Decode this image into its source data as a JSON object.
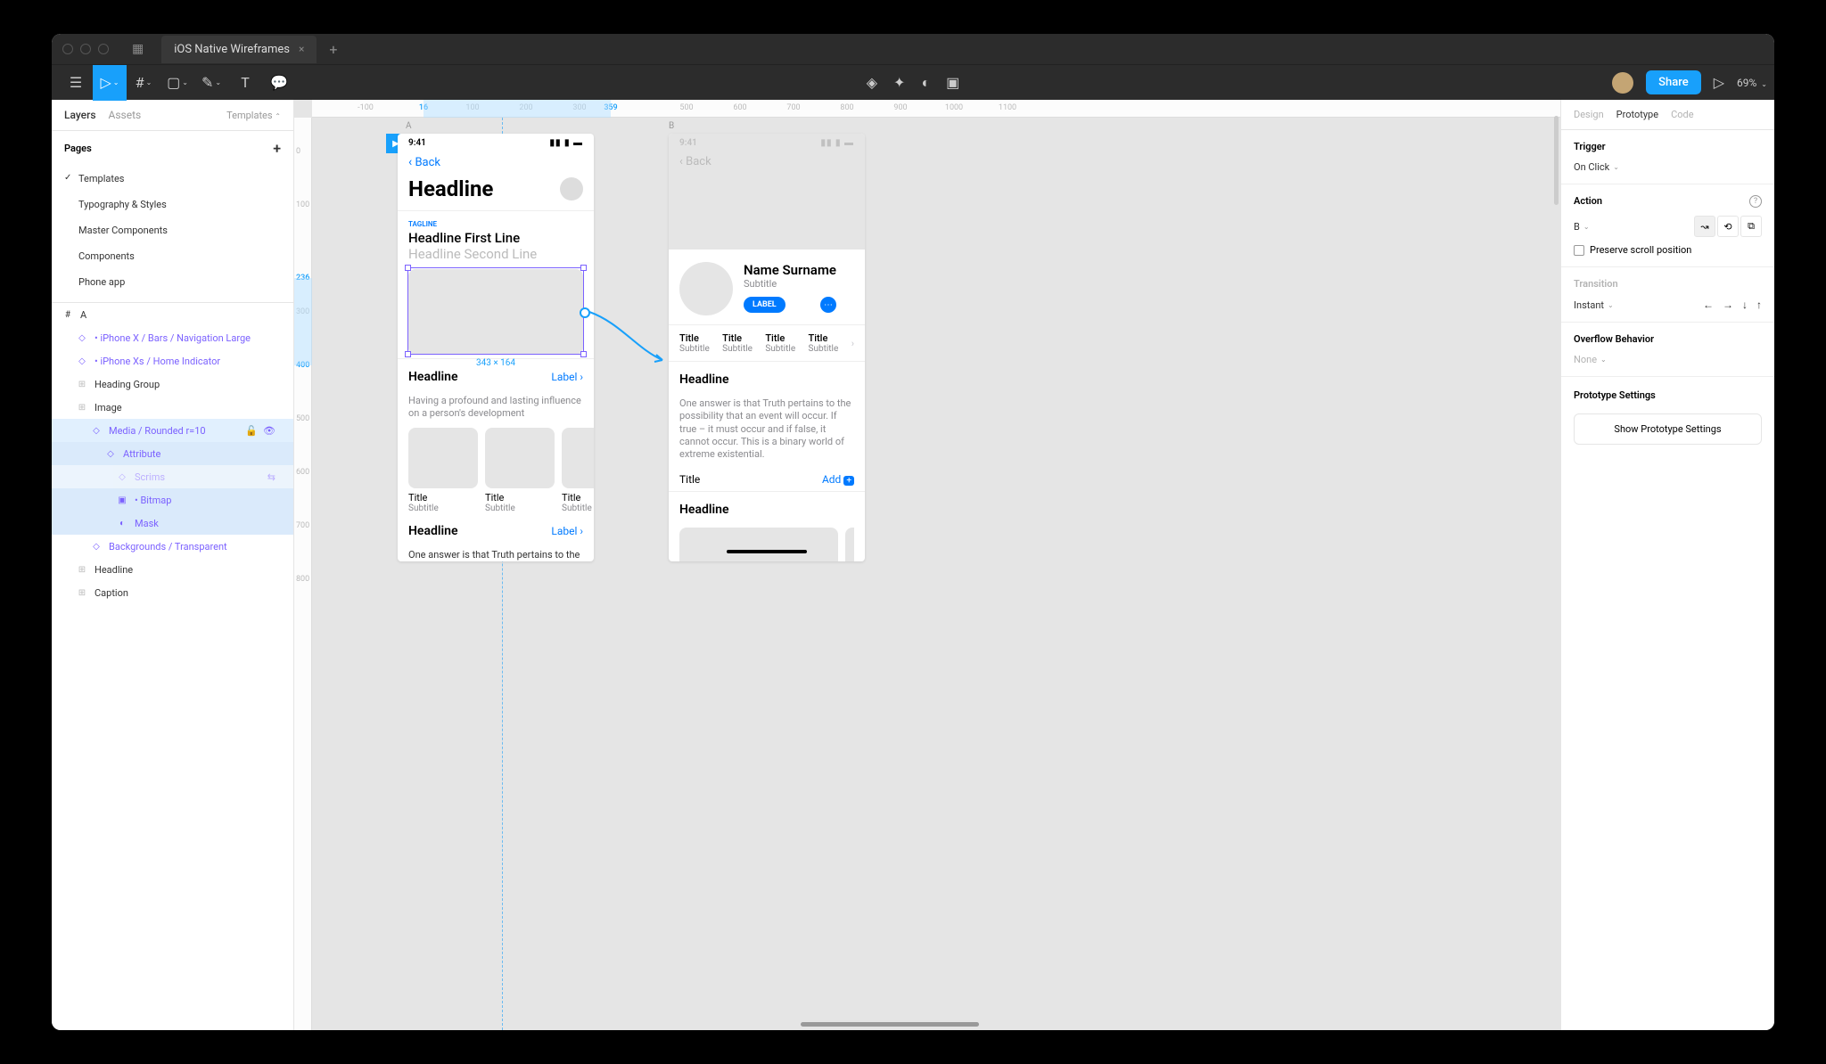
{
  "titlebar": {
    "tab_name": "iOS Native Wireframes"
  },
  "toolbar": {
    "share": "Share",
    "zoom": "69%"
  },
  "left": {
    "tabs": {
      "layers": "Layers",
      "assets": "Assets",
      "templates": "Templates"
    },
    "pages_label": "Pages",
    "pages": [
      "Templates",
      "Typography & Styles",
      "Master Components",
      "Components",
      "Phone app"
    ],
    "frame": "A",
    "layers": {
      "nav_large": "• iPhone X / Bars / Navigation Large",
      "home_ind": "• iPhone Xs / Home Indicator",
      "heading_group": "Heading Group",
      "image": "Image",
      "media_rounded": "Media / Rounded r=10",
      "attribute": "Attribute",
      "scrims": "Scrims",
      "bitmap": "• Bitmap",
      "mask": "Mask",
      "backgrounds": "Backgrounds / Transparent",
      "headline": "Headline",
      "caption": "Caption"
    }
  },
  "ruler": {
    "h": {
      "n100": "-100",
      "p16": "16",
      "p100": "100",
      "p200": "200",
      "p300": "300",
      "p359": "359",
      "p500": "500",
      "p600": "600",
      "p700": "700",
      "p800": "800",
      "p900": "900",
      "p1000": "1000",
      "p1100": "1100"
    },
    "v": {
      "p0": "0",
      "p100": "100",
      "p236": "236",
      "p300": "300",
      "p400": "400",
      "p500": "500",
      "p600": "600",
      "p700": "700",
      "p800": "800"
    }
  },
  "canvas": {
    "frame_a": "A",
    "frame_b": "B",
    "a": {
      "time": "9:41",
      "signals": "▪▪▪ ᯤ ▬",
      "back": "Back",
      "headline": "Headline",
      "tagline": "TAGLINE",
      "h1": "Headline First Line",
      "h2": "Headline Second Line",
      "dim": "343 × 164",
      "sec1_title": "Headline",
      "sec1_link": "Label ›",
      "sec1_body": "Having a profound and lasting influence on a person's development",
      "card_title": "Title",
      "card_sub": "Subtitle",
      "sec2_title": "Headline",
      "sec2_link": "Label ›",
      "sec2_body": "One answer is that Truth pertains to the possibility that an event will occur. If true – it"
    },
    "b": {
      "time": "9:41",
      "back": "Back",
      "name": "Name Surname",
      "subtitle": "Subtitle",
      "label": "LABEL",
      "tab_title": "Title",
      "tab_sub": "Subtitle",
      "sec1_title": "Headline",
      "sec1_body": "One answer is that Truth pertains to the possibility that an event will occur. If true – it must occur and if false, it cannot occur. This is a binary world of extreme existential.",
      "row_title": "Title",
      "row_add": "Add",
      "sec2_title": "Headline"
    }
  },
  "right": {
    "tabs": {
      "design": "Design",
      "prototype": "Prototype",
      "code": "Code"
    },
    "trigger_label": "Trigger",
    "trigger_value": "On Click",
    "action_label": "Action",
    "action_value": "B",
    "preserve": "Preserve scroll position",
    "transition_label": "Transition",
    "transition_value": "Instant",
    "overflow_label": "Overflow Behavior",
    "overflow_value": "None",
    "proto_settings_label": "Prototype Settings",
    "proto_button": "Show Prototype Settings"
  }
}
